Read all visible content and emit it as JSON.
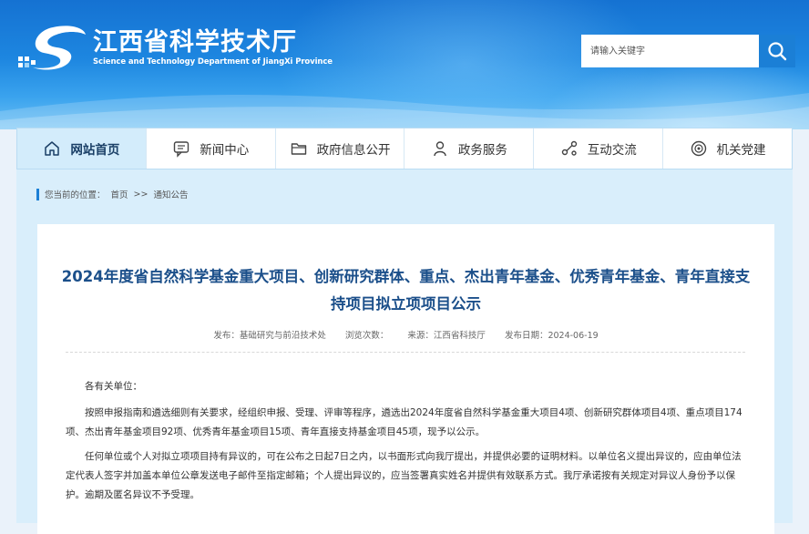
{
  "header": {
    "title": "江西省科学技术厅",
    "subtitle": "Science and Technology Department of JiangXi Province",
    "logo_icon": "jiangxi-science-logo",
    "colors": {
      "banner": "#1d86e0",
      "accent": "#1b7fd6",
      "title": "#1b4f8a"
    }
  },
  "search": {
    "placeholder": "请输入关键字",
    "icon": "search-icon"
  },
  "nav": {
    "items": [
      {
        "label": "网站首页",
        "icon": "home-icon",
        "active": true
      },
      {
        "label": "新闻中心",
        "icon": "chat-icon",
        "active": false
      },
      {
        "label": "政府信息公开",
        "icon": "folder-icon",
        "active": false
      },
      {
        "label": "政务服务",
        "icon": "person-icon",
        "active": false
      },
      {
        "label": "互动交流",
        "icon": "share-icon",
        "active": false
      },
      {
        "label": "机关党建",
        "icon": "badge-icon",
        "active": false
      }
    ]
  },
  "breadcrumb": {
    "prefix": "您当前的位置：",
    "home": "首页",
    "separator": ">>",
    "current": "通知公告"
  },
  "article": {
    "title": "2024年度省自然科学基金重大项目、创新研究群体、重点、杰出青年基金、优秀青年基金、青年直接支持项目拟立项项目公示",
    "meta": {
      "publisher": "发布：基础研究与前沿技术处",
      "views": "浏览次数：",
      "source": "来源：江西省科技厅",
      "date": "发布日期：2024-06-19"
    },
    "greeting": "各有关单位：",
    "paragraphs": [
      "按照申报指南和遴选细则有关要求，经组织申报、受理、评审等程序，遴选出2024年度省自然科学基金重大项目4项、创新研究群体项目4项、重点项目174项、杰出青年基金项目92项、优秀青年基金项目15项、青年直接支持基金项目45项，现予以公示。",
      "任何单位或个人对拟立项项目持有异议的，可在公布之日起7日之内，以书面形式向我厅提出，并提供必要的证明材料。以单位名义提出异议的，应由单位法定代表人签字并加盖本单位公章发送电子邮件至指定邮箱；个人提出异议的，应当签署真实姓名并提供有效联系方式。我厅承诺按有关规定对异议人身份予以保护。逾期及匿名异议不予受理。"
    ]
  }
}
